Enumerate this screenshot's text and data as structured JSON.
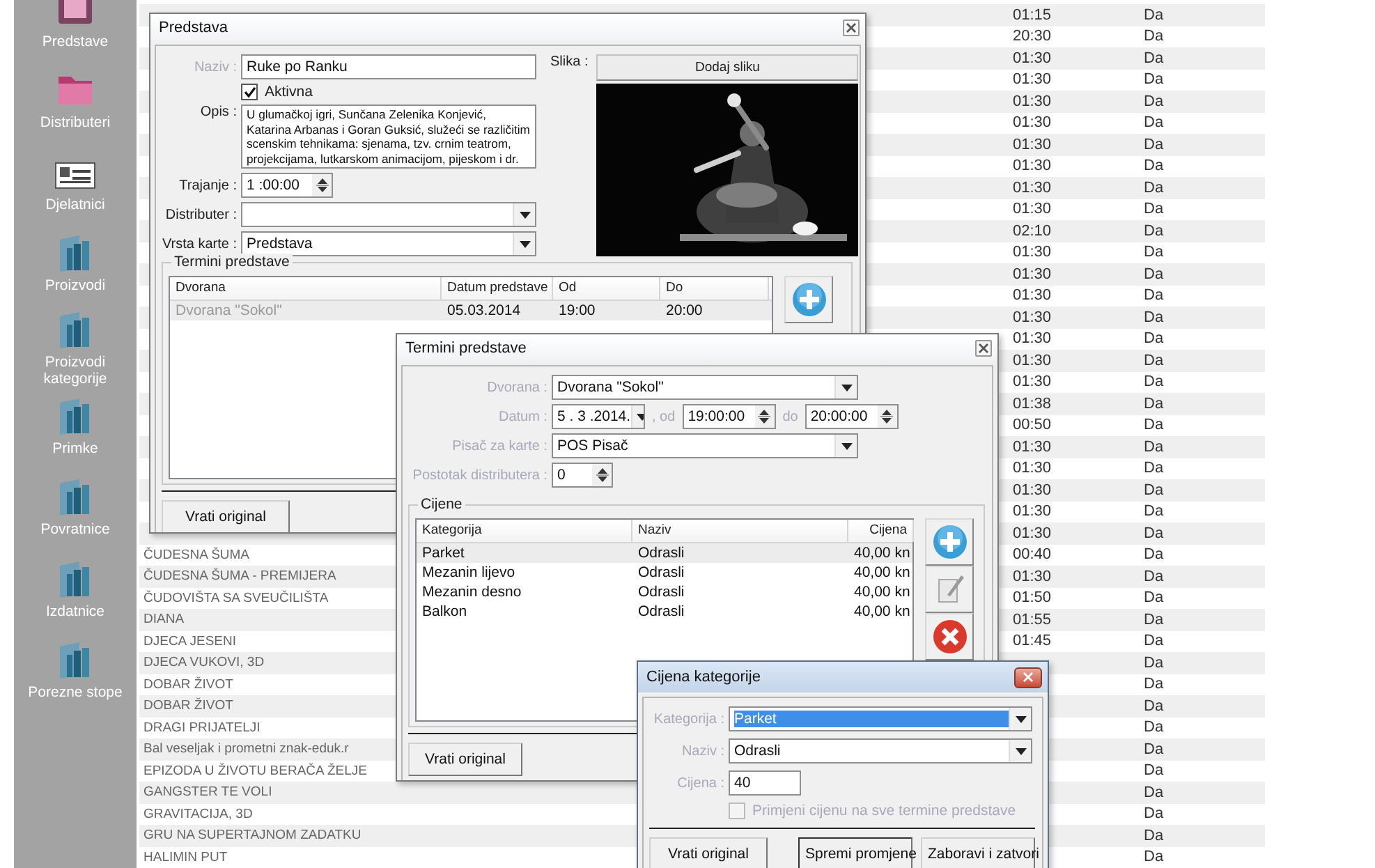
{
  "sidebar": {
    "items": [
      {
        "label": "Predstave",
        "kind": "theatre"
      },
      {
        "label": "Distributeri",
        "kind": "folder"
      },
      {
        "label": "Djelatnici",
        "kind": "card"
      },
      {
        "label": "Proizvodi",
        "kind": "books"
      },
      {
        "label": "Proizvodi kategorije",
        "kind": "books"
      },
      {
        "label": "Primke",
        "kind": "books"
      },
      {
        "label": "Povratnice",
        "kind": "books"
      },
      {
        "label": "Izdatnice",
        "kind": "books"
      },
      {
        "label": "Porezne stope",
        "kind": "books"
      }
    ]
  },
  "list": {
    "rows": [
      {
        "duration": "01:15",
        "active": "Da"
      },
      {
        "duration": "20:30",
        "active": "Da"
      },
      {
        "duration": "01:30",
        "active": "Da"
      },
      {
        "duration": "01:30",
        "active": "Da"
      },
      {
        "duration": "01:30",
        "active": "Da"
      },
      {
        "duration": "01:30",
        "active": "Da"
      },
      {
        "duration": "01:30",
        "active": "Da"
      },
      {
        "duration": "01:30",
        "active": "Da"
      },
      {
        "duration": "01:30",
        "active": "Da"
      },
      {
        "duration": "01:30",
        "active": "Da"
      },
      {
        "duration": "02:10",
        "active": "Da"
      },
      {
        "duration": "01:30",
        "active": "Da"
      },
      {
        "duration": "01:30",
        "active": "Da"
      },
      {
        "duration": "01:30",
        "active": "Da"
      },
      {
        "duration": "01:30",
        "active": "Da"
      },
      {
        "duration": "01:30",
        "active": "Da"
      },
      {
        "duration": "01:30",
        "active": "Da"
      },
      {
        "duration": "01:30",
        "active": "Da"
      },
      {
        "duration": "01:38",
        "active": "Da"
      },
      {
        "duration": "00:50",
        "active": "Da"
      },
      {
        "duration": "01:30",
        "active": "Da"
      },
      {
        "duration": "01:30",
        "active": "Da"
      },
      {
        "duration": "01:30",
        "active": "Da"
      },
      {
        "duration": "01:30",
        "active": "Da"
      },
      {
        "duration": "01:30",
        "active": "Da"
      },
      {
        "name": "ČUDESNA ŠUMA",
        "duration": "00:40",
        "active": "Da"
      },
      {
        "name": "ČUDESNA ŠUMA - PREMIJERA",
        "duration": "01:30",
        "active": "Da"
      },
      {
        "name": "ČUDOVIŠTA SA SVEUČILIŠTA",
        "duration": "01:50",
        "active": "Da"
      },
      {
        "name": "DIANA",
        "duration": "01:55",
        "active": "Da"
      },
      {
        "name": "DJECA JESENI",
        "duration": "01:45",
        "active": "Da"
      },
      {
        "name": "DJECA VUKOVI, 3D",
        "active": "Da"
      },
      {
        "name": "DOBAR ŽIVOT",
        "active": "Da"
      },
      {
        "name": "DOBAR ŽIVOT",
        "active": "Da"
      },
      {
        "name": "DRAGI PRIJATELJI",
        "active": "Da"
      },
      {
        "name": "Bal veseljak i prometni znak-eduk.r",
        "active": "Da"
      },
      {
        "name": "EPIZODA U ŽIVOTU BERAČA ŽELJE",
        "active": "Da"
      },
      {
        "name": "GANGSTER TE VOLI",
        "active": "Da"
      },
      {
        "name": "GRAVITACIJA, 3D",
        "active": "Da"
      },
      {
        "name": "GRU NA SUPERTAJNOM ZADATKU",
        "active": "Da"
      },
      {
        "name": "HALIMIN PUT",
        "active": "Da"
      }
    ]
  },
  "predstava": {
    "title": "Predstava",
    "fields": [
      {
        "kind": "text",
        "label": "Naziv :",
        "value": "Ruke po Ranku",
        "disabled": true
      },
      {
        "kind": "checkbox",
        "label": "Aktivna",
        "checked": true,
        "disabled": false
      },
      {
        "kind": "textarea",
        "label": "Opis :",
        "value": "U glumačkoj igri, Sunčana Zelenika Konjević, Katarina Arbanas i Goran Guksić, služeći se različitim scenskim tehnikama: sjenama, tzv. crnim teatrom, projekcijama, lutkarskom animacijom, pijeskom i dr.",
        "disabled": false
      },
      {
        "kind": "spinner",
        "label": "Trajanje :",
        "value": "1 :00:00",
        "disabled": false
      },
      {
        "kind": "combo",
        "label": "Distributer :",
        "disabled": false
      },
      {
        "kind": "combo",
        "label": "Vrsta karte :",
        "value": "Predstava",
        "disabled": false
      }
    ],
    "image_label": "Slika :",
    "image_button": "Dodaj sliku",
    "schedule": {
      "title": "Termini predstave",
      "columns": [
        "Dvorana",
        "Datum predstave",
        "Od",
        "Do"
      ],
      "rows": [
        {
          "cells": [
            "Dvorana \"Sokol\"",
            "05.03.2014",
            "19:00",
            "20:00"
          ],
          "selected": true
        }
      ]
    },
    "footer_button": "Vrati original"
  },
  "termini": {
    "title": "Termini predstave",
    "fields": [
      {
        "kind": "combo",
        "label": "Dvorana :",
        "value": "Dvorana \"Sokol\"",
        "disabled": true
      },
      {
        "kind": "daterange",
        "label": "Datum :",
        "value": "5 . 3 .2014.",
        "from_label": ", od",
        "from": "19:00:00",
        "to_label": "do",
        "to": "20:00:00",
        "disabled": true
      },
      {
        "kind": "combo",
        "label": "Pisač za karte :",
        "value": "POS Pisač",
        "disabled": true
      },
      {
        "kind": "spinner",
        "label": "Postotak distributera :",
        "value": "0",
        "disabled": true
      }
    ],
    "prices": {
      "title": "Cijene",
      "columns": [
        "Kategorija",
        "Naziv",
        "Cijena"
      ],
      "rows": [
        {
          "cells": [
            "Parket",
            "Odrasli",
            "40,00 kn"
          ],
          "selected": true
        },
        {
          "cells": [
            "Mezanin lijevo",
            "Odrasli",
            "40,00 kn"
          ],
          "selected": false
        },
        {
          "cells": [
            "Mezanin desno",
            "Odrasli",
            "40,00 kn"
          ],
          "selected": false
        },
        {
          "cells": [
            "Balkon",
            "Odrasli",
            "40,00 kn"
          ],
          "selected": false
        }
      ]
    },
    "footer_button": "Vrati original"
  },
  "cijena": {
    "title": "Cijena kategorije",
    "fields": [
      {
        "kind": "combo",
        "label": "Kategorija :",
        "value": "Parket",
        "disabled": true,
        "highlighted": true
      },
      {
        "kind": "combo",
        "label": "Naziv :",
        "value": "Odrasli",
        "disabled": true,
        "highlighted": false
      },
      {
        "kind": "text",
        "label": "Cijena :",
        "value": "40",
        "disabled": true,
        "highlighted": false
      },
      {
        "kind": "checkbox",
        "label": "Primjeni cijenu na sve termine predstave",
        "checked": false,
        "disabled": true
      }
    ],
    "buttons": [
      {
        "label": "Vrati original",
        "default": false
      },
      {
        "label": "Spremi promjene",
        "default": true
      },
      {
        "label": "Zaboravi i zatvori",
        "default": false
      }
    ]
  }
}
